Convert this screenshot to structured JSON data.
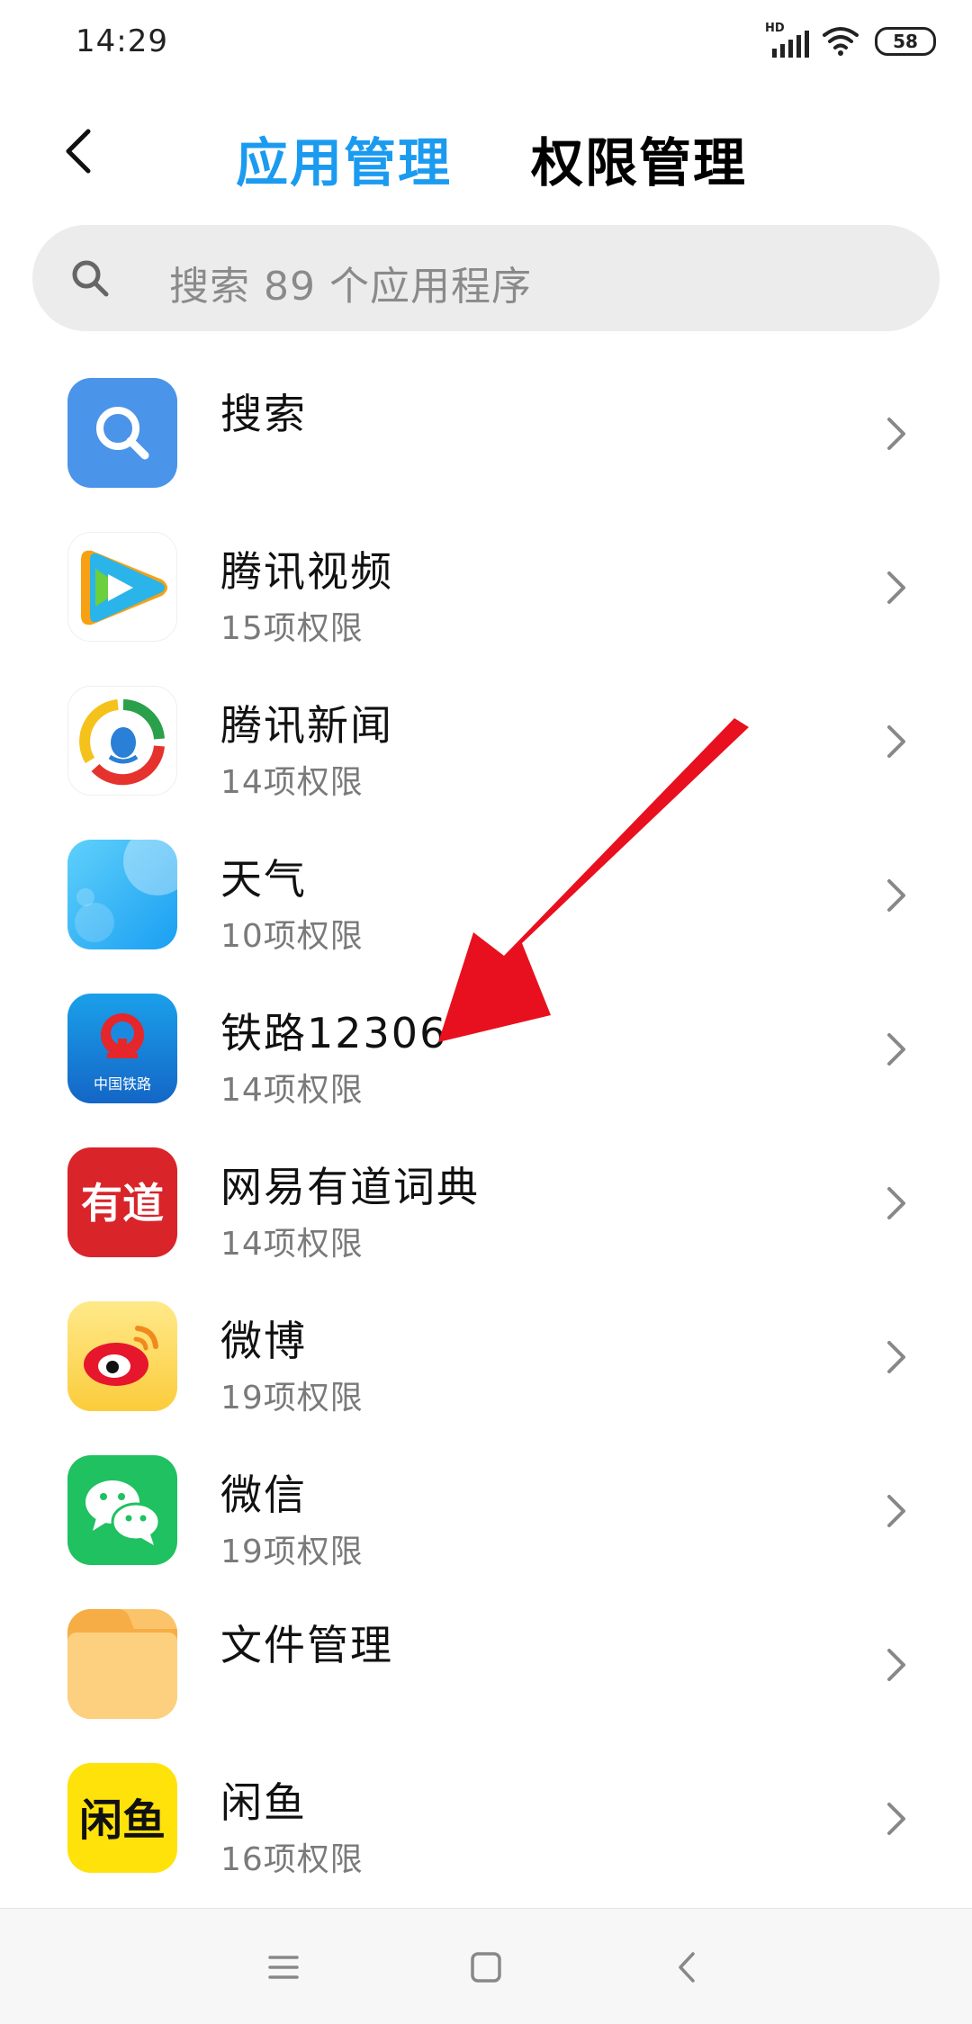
{
  "status_bar": {
    "time": "14:29",
    "network_label": "HD",
    "battery": "58"
  },
  "header": {
    "tabs": [
      {
        "label": "应用管理",
        "active": true
      },
      {
        "label": "权限管理",
        "active": false
      }
    ],
    "accent_color": "#1b9bf0"
  },
  "search": {
    "placeholder": "搜索 89 个应用程序"
  },
  "apps": [
    {
      "name": "搜索",
      "permissions": "",
      "icon": "search-app-icon"
    },
    {
      "name": "腾讯视频",
      "permissions": "15项权限",
      "icon": "tencent-video-icon"
    },
    {
      "name": "腾讯新闻",
      "permissions": "14项权限",
      "icon": "tencent-news-icon"
    },
    {
      "name": "天气",
      "permissions": "10项权限",
      "icon": "weather-icon"
    },
    {
      "name": "铁路12306",
      "permissions": "14项权限",
      "icon": "railway-12306-icon",
      "icon_text": "中国铁路"
    },
    {
      "name": "网易有道词典",
      "permissions": "14项权限",
      "icon": "youdao-dict-icon",
      "icon_text": "有道"
    },
    {
      "name": "微博",
      "permissions": "19项权限",
      "icon": "weibo-icon"
    },
    {
      "name": "微信",
      "permissions": "19项权限",
      "icon": "wechat-icon"
    },
    {
      "name": "文件管理",
      "permissions": "",
      "icon": "file-manager-icon"
    },
    {
      "name": "闲鱼",
      "permissions": "16项权限",
      "icon": "xianyu-icon",
      "icon_text": "闲鱼"
    }
  ],
  "annotation": {
    "color": "#e8101e"
  },
  "nav": {
    "items": [
      "menu",
      "home",
      "back"
    ]
  }
}
